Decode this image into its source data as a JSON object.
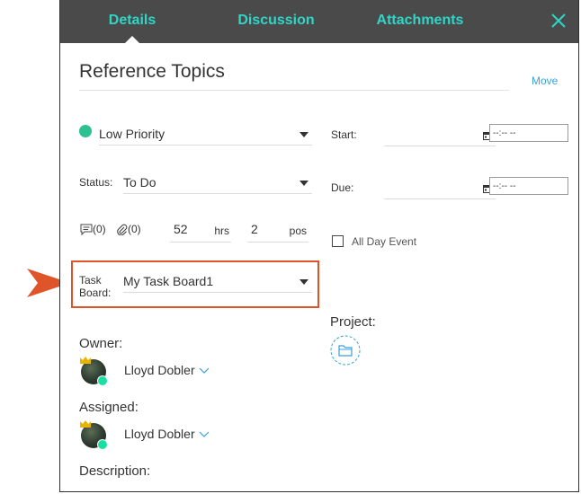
{
  "tabs": {
    "details": "Details",
    "discussion": "Discussion",
    "attachments": "Attachments"
  },
  "header": {
    "title": "Reference Topics",
    "move_link": "Move"
  },
  "priority": {
    "value": "Low Priority",
    "color": "#2ec190"
  },
  "status": {
    "label": "Status:",
    "value": "To Do"
  },
  "dates": {
    "start_label": "Start:",
    "due_label": "Due:",
    "start_time": "--:-- --",
    "due_time": "--:-- --"
  },
  "counts": {
    "comments": "(0)",
    "attachments": "(0)",
    "hours_value": "52",
    "hours_unit": "hrs",
    "points_value": "2",
    "points_unit": "pos"
  },
  "all_day": {
    "label": "All Day Event",
    "checked": false
  },
  "task_board": {
    "label_line1": "Task",
    "label_line2": "Board:",
    "value": "My Task Board1",
    "highlight_color": "#e0542a"
  },
  "project": {
    "label": "Project:"
  },
  "owner": {
    "label": "Owner:",
    "name": "Lloyd Dobler"
  },
  "assigned": {
    "label": "Assigned:",
    "name": "Lloyd Dobler"
  },
  "description": {
    "label": "Description:"
  },
  "colors": {
    "accent": "#2ed6c8",
    "link": "#3ba1d8",
    "tabbar": "#4a4a4a",
    "callout_arrow": "#e0542a"
  }
}
